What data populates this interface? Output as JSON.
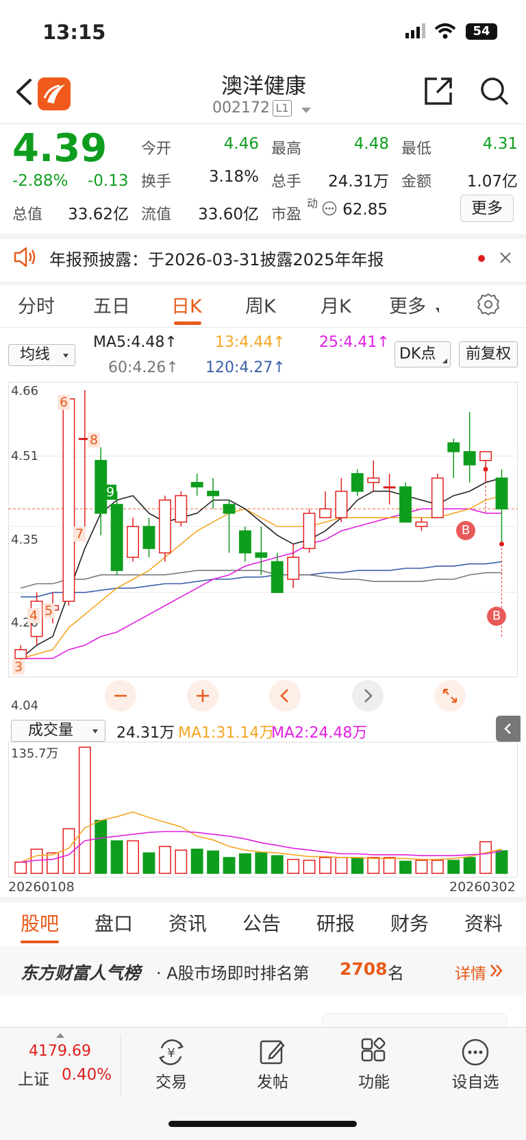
{
  "status": {
    "time": "13:15",
    "battery": "54"
  },
  "header": {
    "title": "澳洋健康",
    "code": "002172",
    "level": "L1"
  },
  "quote": {
    "price": "4.39",
    "change_pct": "-2.88%",
    "change": "-0.13",
    "open_label": "今开",
    "open": "4.46",
    "high_label": "最高",
    "high": "4.48",
    "low_label": "最低",
    "low": "4.31",
    "turnover_label": "换手",
    "turnover": "3.18%",
    "volume_label": "总手",
    "volume": "24.31万",
    "amount_label": "金额",
    "amount": "1.07亿",
    "mktcap_label": "总值",
    "mktcap": "33.62亿",
    "float_label": "流值",
    "float": "33.60亿",
    "pe_label": "市盈",
    "pe_sup": "动",
    "pe": "62.85",
    "more": "更多"
  },
  "notice": {
    "text": "年报预披露：于2026-03-31披露2025年年报"
  },
  "period_tabs": [
    "分时",
    "五日",
    "日K",
    "周K",
    "月K",
    "更多"
  ],
  "ma_panel": {
    "selector": "均线",
    "ma5": "MA5:4.48↑",
    "ma13": "13:4.44↑",
    "ma25": "25:4.41↑",
    "ma60": "60:4.26↑",
    "ma120": "120:4.27↑",
    "dk": "DK点",
    "adjust": "前复权"
  },
  "price_axis": [
    "4.66",
    "4.51",
    "4.35",
    "4.20",
    "4.04"
  ],
  "candle_labels": [
    "3",
    "4",
    "5",
    "6",
    "7",
    "8",
    "9"
  ],
  "markers": [
    "B",
    "B"
  ],
  "volume_panel": {
    "selector": "成交量",
    "vol": "24.31万",
    "ma1": "MA1:31.14万",
    "ma2": "MA2:24.48万",
    "max": "135.7万",
    "start_date": "20260108",
    "end_date": "20260302"
  },
  "bottom_tabs": [
    "股吧",
    "盘口",
    "资讯",
    "公告",
    "研报",
    "财务",
    "资料"
  ],
  "rank": {
    "brand": "东方财富人气榜",
    "text_pre": "· A股市场即时排名第",
    "number": "2708",
    "text_post": "名",
    "detail": "详情"
  },
  "footer": {
    "index_value": "4179.69",
    "index_name": "上证",
    "index_pct": "0.40%",
    "items": [
      "交易",
      "发帖",
      "功能",
      "设自选"
    ]
  },
  "colors": {
    "up": "#e01d1d",
    "down": "#0f9d1e",
    "accent": "#e85a1a",
    "ma5": "#222222",
    "ma13": "#f5a623",
    "ma25": "#e020e0",
    "ma60": "#777777",
    "ma120": "#3a5fa8"
  },
  "chart_data": {
    "type": "candlestick",
    "ylim": [
      4.04,
      4.66
    ],
    "candles": [
      {
        "o": 4.05,
        "c": 4.07,
        "h": 4.08,
        "l": 4.03
      },
      {
        "o": 4.1,
        "c": 4.18,
        "h": 4.2,
        "l": 4.08
      },
      {
        "o": 4.16,
        "c": 4.17,
        "h": 4.2,
        "l": 4.13
      },
      {
        "o": 4.18,
        "c": 4.64,
        "h": 4.64,
        "l": 4.17
      },
      {
        "o": 4.55,
        "c": 4.55,
        "h": 4.66,
        "l": 4.33
      },
      {
        "o": 4.5,
        "c": 4.38,
        "h": 4.53,
        "l": 4.33
      },
      {
        "o": 4.4,
        "c": 4.25,
        "h": 4.43,
        "l": 4.24
      },
      {
        "o": 4.28,
        "c": 4.35,
        "h": 4.37,
        "l": 4.27
      },
      {
        "o": 4.35,
        "c": 4.3,
        "h": 4.37,
        "l": 4.28
      },
      {
        "o": 4.29,
        "c": 4.41,
        "h": 4.42,
        "l": 4.27
      },
      {
        "o": 4.36,
        "c": 4.42,
        "h": 4.43,
        "l": 4.35
      },
      {
        "o": 4.45,
        "c": 4.44,
        "h": 4.47,
        "l": 4.42
      },
      {
        "o": 4.43,
        "c": 4.42,
        "h": 4.46,
        "l": 4.39
      },
      {
        "o": 4.4,
        "c": 4.38,
        "h": 4.41,
        "l": 4.29
      },
      {
        "o": 4.34,
        "c": 4.29,
        "h": 4.35,
        "l": 4.27
      },
      {
        "o": 4.29,
        "c": 4.28,
        "h": 4.35,
        "l": 4.24
      },
      {
        "o": 4.27,
        "c": 4.2,
        "h": 4.29,
        "l": 4.2
      },
      {
        "o": 4.23,
        "c": 4.28,
        "h": 4.31,
        "l": 4.21
      },
      {
        "o": 4.3,
        "c": 4.38,
        "h": 4.39,
        "l": 4.29
      },
      {
        "o": 4.37,
        "c": 4.39,
        "h": 4.43,
        "l": 4.37
      },
      {
        "o": 4.37,
        "c": 4.43,
        "h": 4.46,
        "l": 4.36
      },
      {
        "o": 4.47,
        "c": 4.43,
        "h": 4.48,
        "l": 4.42
      },
      {
        "o": 4.45,
        "c": 4.46,
        "h": 4.5,
        "l": 4.43
      },
      {
        "o": 4.44,
        "c": 4.44,
        "h": 4.47,
        "l": 4.4
      },
      {
        "o": 4.44,
        "c": 4.36,
        "h": 4.45,
        "l": 4.36
      },
      {
        "o": 4.35,
        "c": 4.36,
        "h": 4.37,
        "l": 4.34
      },
      {
        "o": 4.37,
        "c": 4.46,
        "h": 4.47,
        "l": 4.37
      },
      {
        "o": 4.54,
        "c": 4.52,
        "h": 4.55,
        "l": 4.46
      },
      {
        "o": 4.52,
        "c": 4.49,
        "h": 4.61,
        "l": 4.45
      },
      {
        "o": 4.5,
        "c": 4.52,
        "h": 4.52,
        "l": 4.45
      },
      {
        "o": 4.46,
        "c": 4.39,
        "h": 4.48,
        "l": 4.31
      }
    ],
    "ma5": [
      4.05,
      4.08,
      4.1,
      4.2,
      4.3,
      4.38,
      4.41,
      4.42,
      4.38,
      4.36,
      4.37,
      4.38,
      4.41,
      4.41,
      4.39,
      4.36,
      4.33,
      4.31,
      4.32,
      4.34,
      4.37,
      4.41,
      4.43,
      4.43,
      4.42,
      4.41,
      4.4,
      4.42,
      4.43,
      4.45,
      4.46
    ],
    "ma13": [
      4.05,
      4.06,
      4.07,
      4.12,
      4.15,
      4.18,
      4.21,
      4.23,
      4.25,
      4.28,
      4.31,
      4.34,
      4.36,
      4.38,
      4.39,
      4.37,
      4.35,
      4.35,
      4.35,
      4.36,
      4.37,
      4.37,
      4.37,
      4.37,
      4.37,
      4.37,
      4.37,
      4.38,
      4.39,
      4.41,
      4.42
    ],
    "ma25": [
      4.05,
      4.05,
      4.05,
      4.07,
      4.08,
      4.1,
      4.11,
      4.13,
      4.15,
      4.17,
      4.19,
      4.21,
      4.23,
      4.24,
      4.26,
      4.27,
      4.28,
      4.29,
      4.31,
      4.32,
      4.34,
      4.35,
      4.36,
      4.37,
      4.38,
      4.39,
      4.39,
      4.39,
      4.39,
      4.38,
      4.38
    ],
    "ma60": [
      4.21,
      4.22,
      4.22,
      4.23,
      4.23,
      4.24,
      4.24,
      4.24,
      4.24,
      4.24,
      4.245,
      4.25,
      4.25,
      4.25,
      4.25,
      4.25,
      4.24,
      4.24,
      4.24,
      4.235,
      4.23,
      4.23,
      4.225,
      4.225,
      4.225,
      4.225,
      4.23,
      4.23,
      4.24,
      4.245,
      4.245
    ],
    "ma120": [
      4.19,
      4.19,
      4.2,
      4.2,
      4.2,
      4.205,
      4.21,
      4.21,
      4.215,
      4.22,
      4.22,
      4.225,
      4.23,
      4.23,
      4.235,
      4.235,
      4.24,
      4.24,
      4.24,
      4.245,
      4.245,
      4.25,
      4.25,
      4.25,
      4.255,
      4.255,
      4.26,
      4.26,
      4.265,
      4.265,
      4.27
    ],
    "volume": [
      12,
      26,
      22,
      48,
      135.7,
      57,
      35,
      35,
      22,
      29,
      25,
      26,
      24,
      17,
      21,
      22,
      19,
      15,
      14,
      17,
      17,
      17,
      17,
      17,
      13,
      14,
      14,
      14,
      17,
      34,
      24.31
    ],
    "vol_ma1": [
      12,
      19,
      20,
      27,
      49,
      57,
      61,
      66,
      60,
      55,
      50,
      40,
      36,
      29,
      25,
      23,
      22,
      20,
      18,
      18,
      17,
      17,
      16,
      16,
      16,
      15,
      15,
      16,
      18,
      22,
      26
    ],
    "vol_ma2": [
      12,
      14,
      15,
      20,
      35,
      38,
      40,
      42,
      44,
      45,
      45,
      44,
      42,
      40,
      37,
      33,
      30,
      27,
      25,
      23,
      21,
      21,
      20,
      20,
      20,
      19,
      19,
      19,
      20,
      21,
      24
    ]
  }
}
